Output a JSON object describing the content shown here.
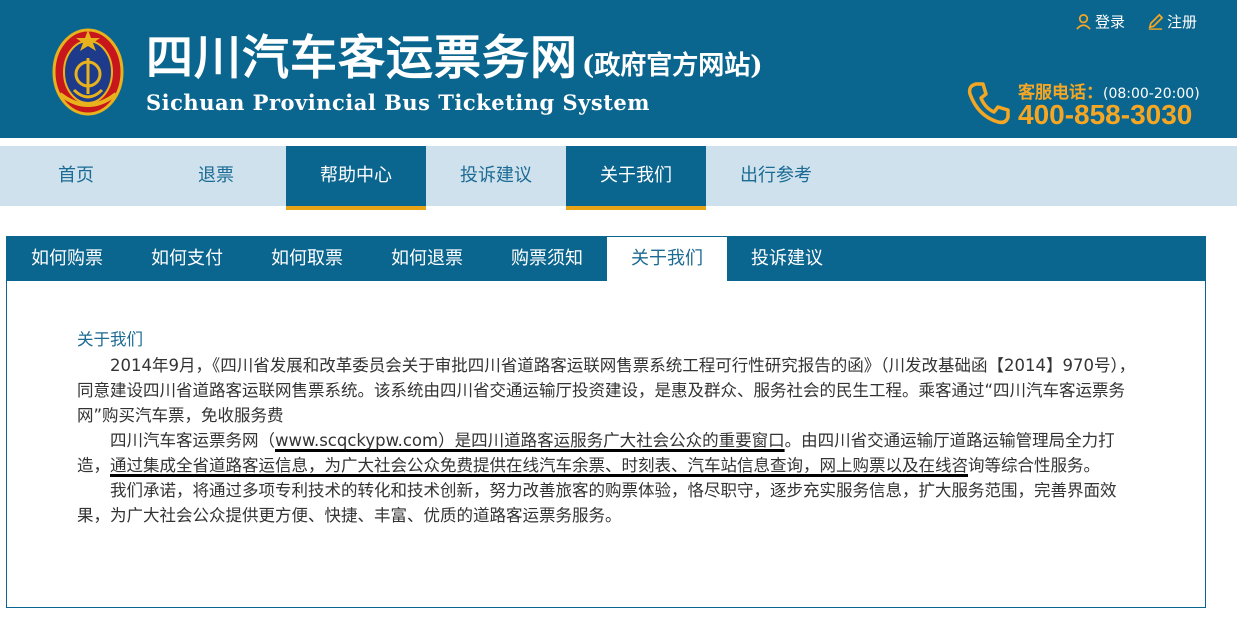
{
  "header": {
    "title_cn": "四川汽车客运票务网",
    "title_cn_suffix": "(政府官方网站)",
    "title_en": "Sichuan Provincial Bus Ticketing System",
    "login_label": "登录",
    "register_label": "注册",
    "hotline_label": "客服电话：",
    "hotline_hours": "(08:00-20:00)",
    "hotline_number": "400-858-3030"
  },
  "mainnav": {
    "items": [
      {
        "label": "首页"
      },
      {
        "label": "退票"
      },
      {
        "label": "帮助中心"
      },
      {
        "label": "投诉建议"
      },
      {
        "label": "关于我们"
      },
      {
        "label": "出行参考"
      }
    ]
  },
  "tabs": [
    {
      "label": "如何购票"
    },
    {
      "label": "如何支付"
    },
    {
      "label": "如何取票"
    },
    {
      "label": "如何退票"
    },
    {
      "label": "购票须知"
    },
    {
      "label": "关于我们"
    },
    {
      "label": "投诉建议"
    }
  ],
  "article": {
    "heading": "关于我们",
    "p1": "2014年9月，《四川省发展和改革委员会关于审批四川省道路客运联网售票系统工程可行性研究报告的函》（川发改基础函【2014】970号），同意建设四川省道路客运联网售票系统。该系统由四川省交通运输厅投资建设，是惠及群众、服务社会的民生工程。乘客通过“四川汽车客运票务网”购买汽车票，免收服务费",
    "p2_a": "四川汽车客运票务网（",
    "p2_b": "www.scqckypw.com）是四川道路客运服务广大社会公众的重要窗口",
    "p2_c": "。由四川省交通运输厅道路运输管理局全力打造，",
    "p2_d": "通过集成全省道路客运信息，为广大社会公众免费提供在线汽车余票、时刻表、汽车站信息查询，网上购票以及在线咨",
    "p2_e": "询等综合性服务。",
    "p3": "我们承诺，将通过多项专利技术的转化和技术创新，努力改善旅客的购票体验，恪尽职守，逐步充实服务信息，扩大服务范围，完善界面效果，为广大社会公众提供更方便、快捷、丰富、优质的道路客运票务服务。"
  },
  "colors": {
    "brand_blue": "#0b668f",
    "nav_bg": "#cfe1ec",
    "accent_orange": "#f5a623",
    "active_underline": "#e8a317"
  }
}
